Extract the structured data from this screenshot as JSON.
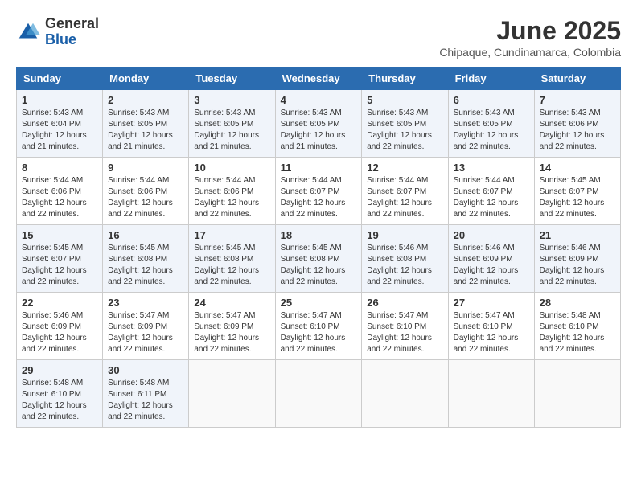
{
  "header": {
    "logo_line1": "General",
    "logo_line2": "Blue",
    "month": "June 2025",
    "location": "Chipaque, Cundinamarca, Colombia"
  },
  "days_of_week": [
    "Sunday",
    "Monday",
    "Tuesday",
    "Wednesday",
    "Thursday",
    "Friday",
    "Saturday"
  ],
  "weeks": [
    [
      {
        "day": "1",
        "sunrise": "5:43 AM",
        "sunset": "6:04 PM",
        "daylight": "12 hours and 21 minutes."
      },
      {
        "day": "2",
        "sunrise": "5:43 AM",
        "sunset": "6:05 PM",
        "daylight": "12 hours and 21 minutes."
      },
      {
        "day": "3",
        "sunrise": "5:43 AM",
        "sunset": "6:05 PM",
        "daylight": "12 hours and 21 minutes."
      },
      {
        "day": "4",
        "sunrise": "5:43 AM",
        "sunset": "6:05 PM",
        "daylight": "12 hours and 21 minutes."
      },
      {
        "day": "5",
        "sunrise": "5:43 AM",
        "sunset": "6:05 PM",
        "daylight": "12 hours and 22 minutes."
      },
      {
        "day": "6",
        "sunrise": "5:43 AM",
        "sunset": "6:05 PM",
        "daylight": "12 hours and 22 minutes."
      },
      {
        "day": "7",
        "sunrise": "5:43 AM",
        "sunset": "6:06 PM",
        "daylight": "12 hours and 22 minutes."
      }
    ],
    [
      {
        "day": "8",
        "sunrise": "5:44 AM",
        "sunset": "6:06 PM",
        "daylight": "12 hours and 22 minutes."
      },
      {
        "day": "9",
        "sunrise": "5:44 AM",
        "sunset": "6:06 PM",
        "daylight": "12 hours and 22 minutes."
      },
      {
        "day": "10",
        "sunrise": "5:44 AM",
        "sunset": "6:06 PM",
        "daylight": "12 hours and 22 minutes."
      },
      {
        "day": "11",
        "sunrise": "5:44 AM",
        "sunset": "6:07 PM",
        "daylight": "12 hours and 22 minutes."
      },
      {
        "day": "12",
        "sunrise": "5:44 AM",
        "sunset": "6:07 PM",
        "daylight": "12 hours and 22 minutes."
      },
      {
        "day": "13",
        "sunrise": "5:44 AM",
        "sunset": "6:07 PM",
        "daylight": "12 hours and 22 minutes."
      },
      {
        "day": "14",
        "sunrise": "5:45 AM",
        "sunset": "6:07 PM",
        "daylight": "12 hours and 22 minutes."
      }
    ],
    [
      {
        "day": "15",
        "sunrise": "5:45 AM",
        "sunset": "6:07 PM",
        "daylight": "12 hours and 22 minutes."
      },
      {
        "day": "16",
        "sunrise": "5:45 AM",
        "sunset": "6:08 PM",
        "daylight": "12 hours and 22 minutes."
      },
      {
        "day": "17",
        "sunrise": "5:45 AM",
        "sunset": "6:08 PM",
        "daylight": "12 hours and 22 minutes."
      },
      {
        "day": "18",
        "sunrise": "5:45 AM",
        "sunset": "6:08 PM",
        "daylight": "12 hours and 22 minutes."
      },
      {
        "day": "19",
        "sunrise": "5:46 AM",
        "sunset": "6:08 PM",
        "daylight": "12 hours and 22 minutes."
      },
      {
        "day": "20",
        "sunrise": "5:46 AM",
        "sunset": "6:09 PM",
        "daylight": "12 hours and 22 minutes."
      },
      {
        "day": "21",
        "sunrise": "5:46 AM",
        "sunset": "6:09 PM",
        "daylight": "12 hours and 22 minutes."
      }
    ],
    [
      {
        "day": "22",
        "sunrise": "5:46 AM",
        "sunset": "6:09 PM",
        "daylight": "12 hours and 22 minutes."
      },
      {
        "day": "23",
        "sunrise": "5:47 AM",
        "sunset": "6:09 PM",
        "daylight": "12 hours and 22 minutes."
      },
      {
        "day": "24",
        "sunrise": "5:47 AM",
        "sunset": "6:09 PM",
        "daylight": "12 hours and 22 minutes."
      },
      {
        "day": "25",
        "sunrise": "5:47 AM",
        "sunset": "6:10 PM",
        "daylight": "12 hours and 22 minutes."
      },
      {
        "day": "26",
        "sunrise": "5:47 AM",
        "sunset": "6:10 PM",
        "daylight": "12 hours and 22 minutes."
      },
      {
        "day": "27",
        "sunrise": "5:47 AM",
        "sunset": "6:10 PM",
        "daylight": "12 hours and 22 minutes."
      },
      {
        "day": "28",
        "sunrise": "5:48 AM",
        "sunset": "6:10 PM",
        "daylight": "12 hours and 22 minutes."
      }
    ],
    [
      {
        "day": "29",
        "sunrise": "5:48 AM",
        "sunset": "6:10 PM",
        "daylight": "12 hours and 22 minutes."
      },
      {
        "day": "30",
        "sunrise": "5:48 AM",
        "sunset": "6:11 PM",
        "daylight": "12 hours and 22 minutes."
      },
      null,
      null,
      null,
      null,
      null
    ]
  ]
}
